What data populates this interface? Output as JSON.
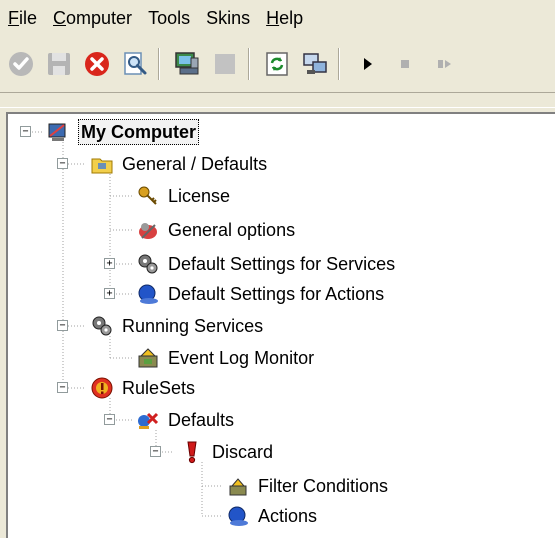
{
  "menu": {
    "items": [
      {
        "label": "File",
        "accel": "F",
        "rest": "ile"
      },
      {
        "label": "Computer",
        "accel": "C",
        "rest": "omputer"
      },
      {
        "label": "Tools",
        "accel": "",
        "rest": "Tools"
      },
      {
        "label": "Skins",
        "accel": "",
        "rest": "Skins"
      },
      {
        "label": "Help",
        "accel": "H",
        "rest": "elp"
      }
    ]
  },
  "toolbar": {
    "buttons": [
      "check-icon",
      "save-icon",
      "delete-icon",
      "search-icon",
      "computer-icon",
      "blank-panel-icon",
      "refresh-icon",
      "network-icon",
      "play-icon",
      "stop-icon",
      "step-icon"
    ]
  },
  "colors": {
    "window_bg": "#ece9d8",
    "tree_bg": "#ffffff",
    "line": "#a0a0a0"
  },
  "tree": {
    "root": "My Computer",
    "general": "General / Defaults",
    "license": "License",
    "general_options": "General options",
    "default_services": "Default Settings for Services",
    "default_actions": "Default Settings for Actions",
    "running_services": "Running Services",
    "event_log_monitor": "Event Log Monitor",
    "rulesets": "RuleSets",
    "defaults": "Defaults",
    "discard": "Discard",
    "filter_conditions": "Filter Conditions",
    "actions": "Actions"
  },
  "expanders": {
    "expanded": "−",
    "collapsed": "+"
  }
}
